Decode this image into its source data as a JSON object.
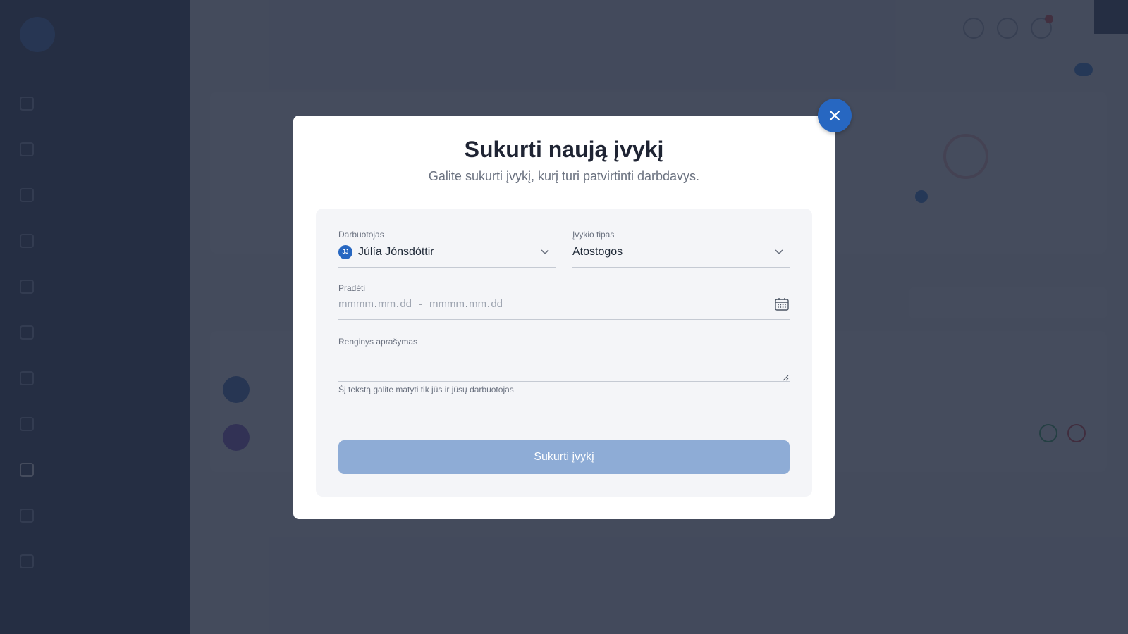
{
  "modal": {
    "title": "Sukurti naują įvykį",
    "subtitle": "Galite sukurti įvykį, kurį turi patvirtinti darbdavys.",
    "employee": {
      "label": "Darbuotojas",
      "initials": "JJ",
      "value": "Júlía Jónsdóttir"
    },
    "event_type": {
      "label": "Įvykio tipas",
      "value": "Atostogos"
    },
    "start": {
      "label": "Pradėti",
      "from": {
        "month": "mmmm",
        "day_month": "mm",
        "day": "dd"
      },
      "separator": "-",
      "to": {
        "month": "mmmm",
        "day_month": "mm",
        "day": "dd"
      }
    },
    "description": {
      "label": "Renginys aprašymas",
      "value": "",
      "hint": "Šį tekstą galite matyti tik jūs ir jūsų darbuotojas"
    },
    "submit_label": "Sukurti įvykį"
  },
  "colors": {
    "accent": "#2767c1",
    "submit_disabled": "#8eacd6",
    "sidebar_bg": "#1e2d4a",
    "overlay": "#262e42"
  }
}
